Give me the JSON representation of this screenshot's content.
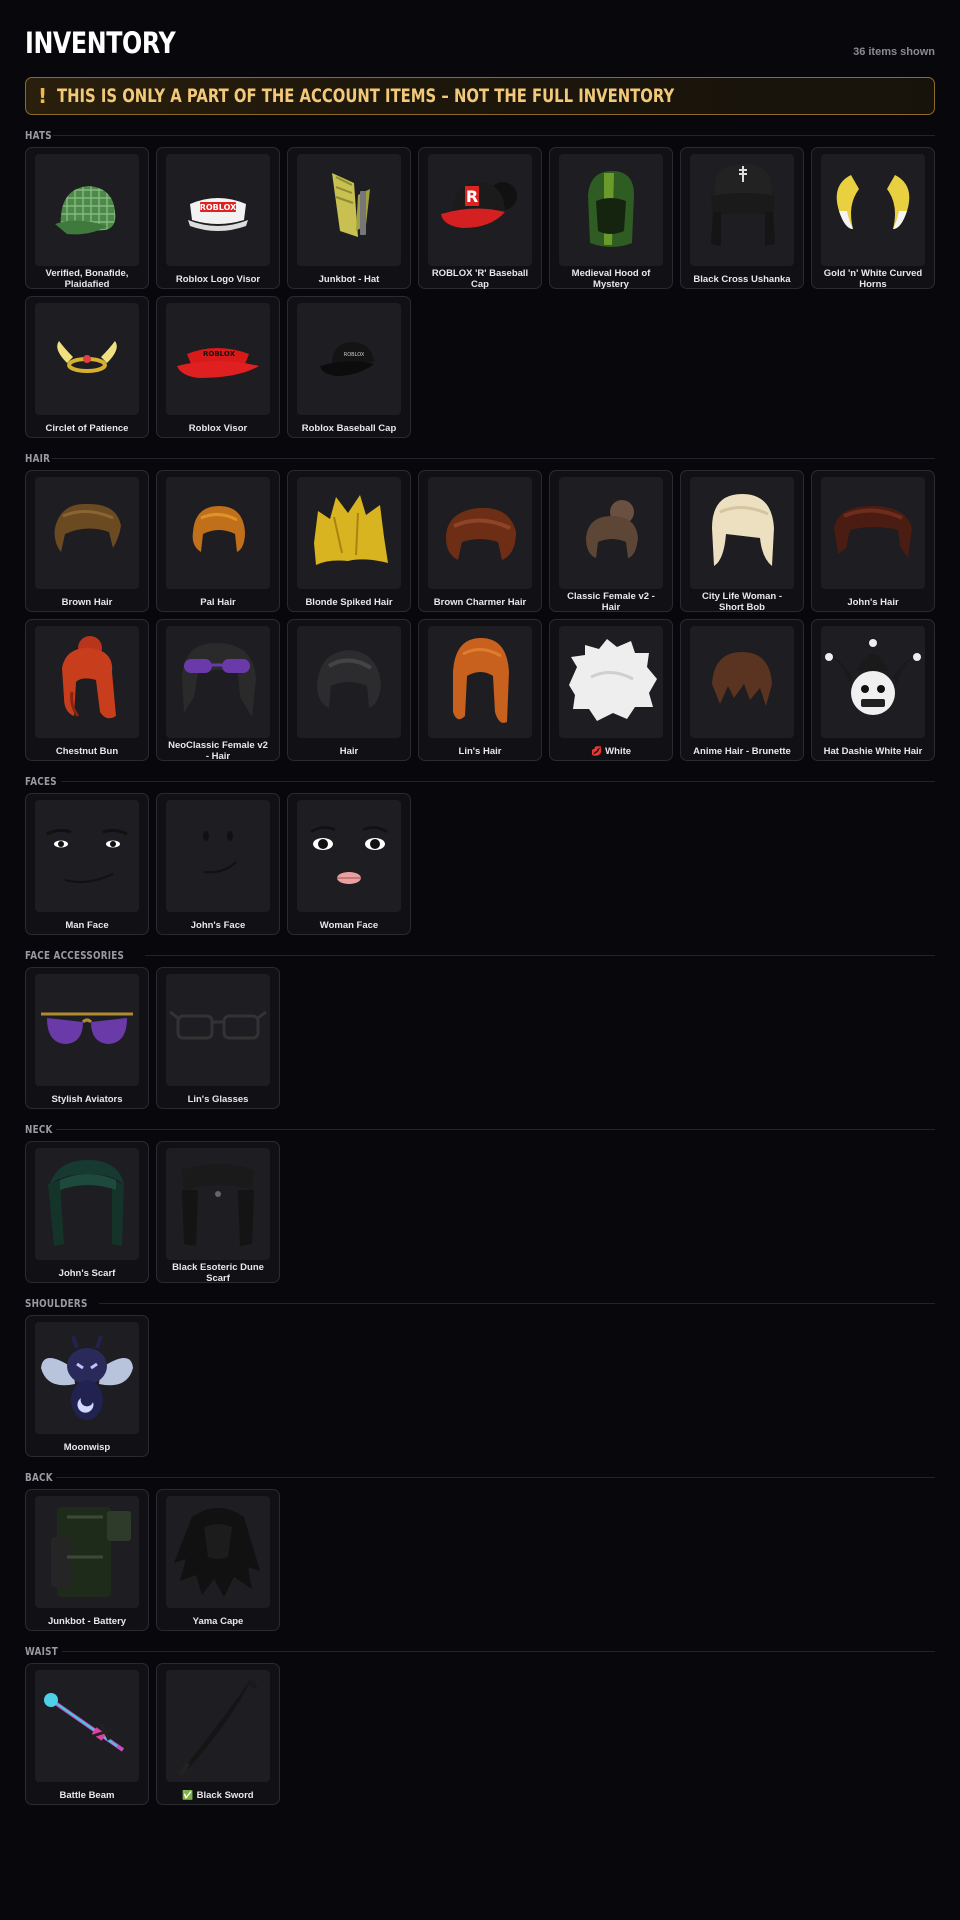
{
  "header": {
    "title": "INVENTORY",
    "count": "36 items shown"
  },
  "warning": {
    "icon": "!",
    "text": "THIS IS ONLY A PART OF THE ACCOUNT ITEMS – NOT THE FULL INVENTORY"
  },
  "sections": [
    {
      "label": "HATS",
      "items": [
        {
          "name": "Verified, Bonafide, Plaidafied",
          "icon": "plaid-cap-icon"
        },
        {
          "name": "Roblox Logo Visor",
          "icon": "white-visor-icon"
        },
        {
          "name": "Junkbot - Hat",
          "icon": "junkbot-hat-icon"
        },
        {
          "name": "ROBLOX 'R' Baseball Cap",
          "icon": "r-baseball-cap-icon"
        },
        {
          "name": "Medieval Hood of Mystery",
          "icon": "green-hood-icon"
        },
        {
          "name": "Black Cross Ushanka",
          "icon": "ushanka-icon"
        },
        {
          "name": "Gold 'n' White Curved Horns",
          "icon": "curved-horns-icon"
        },
        {
          "name": "Circlet of Patience",
          "icon": "winged-circlet-icon"
        },
        {
          "name": "Roblox Visor",
          "icon": "red-visor-icon"
        },
        {
          "name": "Roblox Baseball Cap",
          "icon": "black-cap-icon"
        }
      ]
    },
    {
      "label": "HAIR",
      "items": [
        {
          "name": "Brown Hair",
          "icon": "brown-hair-icon"
        },
        {
          "name": "Pal Hair",
          "icon": "orange-hair-icon"
        },
        {
          "name": "Blonde Spiked Hair",
          "icon": "blonde-spiked-hair-icon"
        },
        {
          "name": "Brown Charmer Hair",
          "icon": "brown-charmer-hair-icon"
        },
        {
          "name": "Classic Female v2 - Hair",
          "icon": "bun-hair-icon"
        },
        {
          "name": "City Life Woman - Short Bob",
          "icon": "short-bob-icon"
        },
        {
          "name": "John's Hair",
          "icon": "johns-hair-icon"
        },
        {
          "name": "Chestnut Bun",
          "icon": "chestnut-bun-icon"
        },
        {
          "name": "NeoClassic Female v2 - Hair",
          "icon": "neoclassic-hair-icon"
        },
        {
          "name": "Hair",
          "icon": "black-hair-icon"
        },
        {
          "name": "Lin's Hair",
          "icon": "lins-hair-icon"
        },
        {
          "name": "White",
          "tag": "💋",
          "icon": "white-hair-icon"
        },
        {
          "name": "Anime Hair - Brunette",
          "icon": "anime-hair-icon"
        },
        {
          "name": "Hat Dashie White Hair",
          "icon": "jester-hat-icon"
        }
      ]
    },
    {
      "label": "FACES",
      "items": [
        {
          "name": "Man Face",
          "icon": "man-face-icon"
        },
        {
          "name": "John's Face",
          "icon": "johns-face-icon"
        },
        {
          "name": "Woman Face",
          "icon": "woman-face-icon"
        }
      ]
    },
    {
      "label": "FACE ACCESSORIES",
      "items": [
        {
          "name": "Stylish Aviators",
          "icon": "aviators-icon"
        },
        {
          "name": "Lin's Glasses",
          "icon": "glasses-icon"
        }
      ]
    },
    {
      "label": "NECK",
      "items": [
        {
          "name": "John's Scarf",
          "icon": "green-scarf-icon"
        },
        {
          "name": "Black Esoteric Dune Scarf",
          "icon": "dune-scarf-icon"
        }
      ]
    },
    {
      "label": "SHOULDERS",
      "items": [
        {
          "name": "Moonwisp",
          "icon": "moonwisp-icon"
        }
      ]
    },
    {
      "label": "BACK",
      "items": [
        {
          "name": "Junkbot - Battery",
          "icon": "battery-icon"
        },
        {
          "name": "Yama Cape",
          "icon": "cape-icon"
        }
      ]
    },
    {
      "label": "WAIST",
      "items": [
        {
          "name": "Battle Beam",
          "icon": "battle-beam-icon"
        },
        {
          "name": "Black Sword",
          "tag": "✅",
          "icon": "black-sword-icon"
        }
      ]
    }
  ]
}
